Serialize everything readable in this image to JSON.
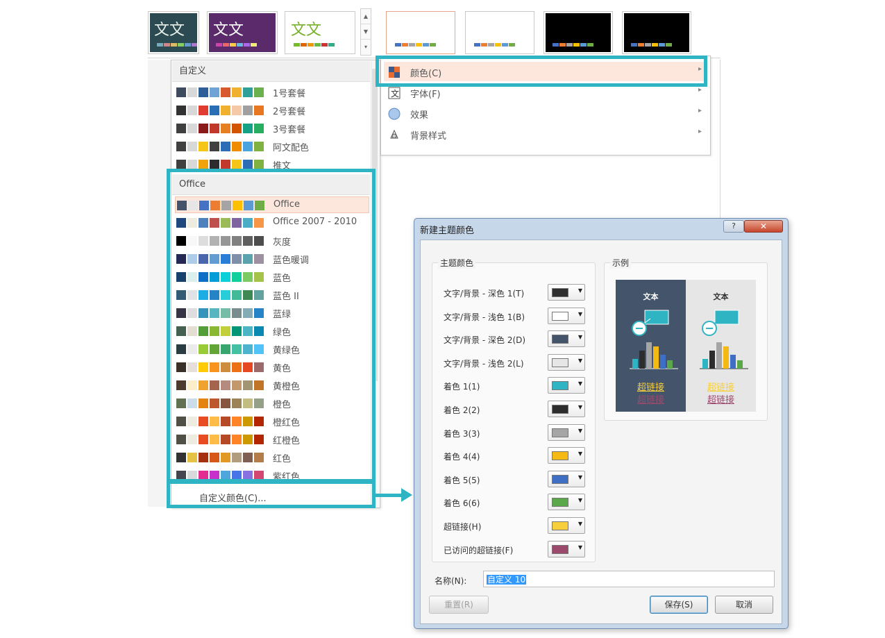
{
  "gallery": {
    "thumbs": [
      {
        "word": "文文",
        "bg": "#2b4a52",
        "fg": "#e8f0e8",
        "bars": [
          "#7ab",
          "#c88",
          "#db6",
          "#8c6",
          "#69c",
          "#a7c"
        ]
      },
      {
        "word": "文文",
        "bg": "#5b2a6b",
        "fg": "#ffffff",
        "bars": [
          "#c4a",
          "#e66",
          "#fc4",
          "#6bd",
          "#a6e",
          "#ee7"
        ]
      },
      {
        "word": "文文",
        "bg": "#ffffff",
        "fg": "#77b02a",
        "bars": [
          "#7b2",
          "#d60",
          "#e90",
          "#6b4",
          "#c33",
          "#3a8"
        ]
      },
      {
        "word": "",
        "bg": "#ffffff",
        "fg": "#000",
        "bars": [
          "#4472c4",
          "#ed7d31",
          "#a5a5a5",
          "#ffc000",
          "#5b9bd5",
          "#70ad47"
        ]
      },
      {
        "word": "",
        "bg": "#ffffff",
        "fg": "#000",
        "bars": [
          "#4472c4",
          "#ed7d31",
          "#a5a5a5",
          "#ffc000",
          "#5b9bd5",
          "#70ad47"
        ]
      },
      {
        "word": "",
        "bg": "#000000",
        "fg": "#fff",
        "bars": [
          "#4472c4",
          "#ed7d31",
          "#a5a5a5",
          "#ffc000",
          "#5b9bd5",
          "#70ad47"
        ]
      },
      {
        "word": "",
        "bg": "#000000",
        "fg": "#fff",
        "bars": [
          "#4472c4",
          "#ed7d31",
          "#a5a5a5",
          "#ffc000",
          "#5b9bd5",
          "#70ad47"
        ]
      }
    ]
  },
  "color_menu": {
    "custom_header": "自定义",
    "office_header": "Office",
    "custom_schemes": [
      {
        "name": "1号套餐",
        "colors": [
          "#3e4a5e",
          "#d8d8d8",
          "#2e5f99",
          "#6fa3d6",
          "#d75a2c",
          "#f0b030",
          "#2f9f9a",
          "#6ab04c"
        ]
      },
      {
        "name": "2号套餐",
        "colors": [
          "#333333",
          "#d8d8d8",
          "#e03c31",
          "#2a6eb5",
          "#f0b030",
          "#f5c8a8",
          "#a0a0a0",
          "#e87722"
        ]
      },
      {
        "name": "3号套餐",
        "colors": [
          "#404040",
          "#d8d8d8",
          "#8b1a1a",
          "#c0392b",
          "#e67e22",
          "#d35400",
          "#16a085",
          "#27ae60"
        ]
      },
      {
        "name": "阿文配色",
        "colors": [
          "#404040",
          "#d8d8d8",
          "#f5c518",
          "#404040",
          "#2d6db5",
          "#f08c00",
          "#4aa3df",
          "#7fb241"
        ]
      },
      {
        "name": "推文",
        "colors": [
          "#404040",
          "#d8d8d8",
          "#f0a30a",
          "#2d2d2d",
          "#c0392b",
          "#f5c518",
          "#2d6db5",
          "#7fb241"
        ]
      }
    ],
    "office_schemes": [
      {
        "name": "Office",
        "colors": [
          "#44546a",
          "#e7e6e6",
          "#4472c4",
          "#ed7d31",
          "#a5a5a5",
          "#ffc000",
          "#5b9bd5",
          "#70ad47"
        ]
      },
      {
        "name": "Office 2007 - 2010",
        "colors": [
          "#1f497d",
          "#eeece1",
          "#4f81bd",
          "#c0504d",
          "#9bbb59",
          "#8064a2",
          "#4bacc6",
          "#f79646"
        ]
      },
      {
        "name": "灰度",
        "colors": [
          "#000000",
          "#f8f8f8",
          "#dddddd",
          "#b2b2b2",
          "#969696",
          "#808080",
          "#5f5f5f",
          "#4d4d4d"
        ]
      },
      {
        "name": "蓝色暖调",
        "colors": [
          "#242852",
          "#acccea",
          "#4a66ac",
          "#629dd1",
          "#297fd5",
          "#7f8fa9",
          "#5aa2ae",
          "#9d90a0"
        ]
      },
      {
        "name": "蓝色",
        "colors": [
          "#17406d",
          "#dbefef",
          "#0f6fc6",
          "#009dd9",
          "#0bd0d9",
          "#10cf9b",
          "#7cca62",
          "#a5c249"
        ]
      },
      {
        "name": "蓝色 II",
        "colors": [
          "#335b74",
          "#dfe3e5",
          "#1cade4",
          "#2683c6",
          "#27ced7",
          "#42ba97",
          "#3e8853",
          "#62a39f"
        ]
      },
      {
        "name": "蓝绿",
        "colors": [
          "#373545",
          "#dedede",
          "#3494ba",
          "#58b6c0",
          "#75bda7",
          "#7a8c8e",
          "#84acb6",
          "#2683c6"
        ]
      },
      {
        "name": "绿色",
        "colors": [
          "#455f51",
          "#e3ded1",
          "#549e39",
          "#8ab833",
          "#c0cf3a",
          "#029676",
          "#4ab5c4",
          "#0989b1"
        ]
      },
      {
        "name": "黄绿色",
        "colors": [
          "#2c3c43",
          "#ebebeb",
          "#99cb38",
          "#63a537",
          "#37a76f",
          "#44c1a3",
          "#4eb3cf",
          "#51c3f9"
        ]
      },
      {
        "name": "黄色",
        "colors": [
          "#39302a",
          "#e5dedb",
          "#ffca08",
          "#f8931d",
          "#ce8d3e",
          "#ec7016",
          "#e64823",
          "#9c6a6a"
        ]
      },
      {
        "name": "黄橙色",
        "colors": [
          "#4e3b30",
          "#fbeec9",
          "#f0a22e",
          "#a5644e",
          "#b58b80",
          "#c3986d",
          "#a19574",
          "#c17529"
        ]
      },
      {
        "name": "橙色",
        "colors": [
          "#637052",
          "#ccddea",
          "#e48312",
          "#bd582c",
          "#865640",
          "#9b8357",
          "#c2bc80",
          "#94a088"
        ]
      },
      {
        "name": "橙红色",
        "colors": [
          "#505046",
          "#eeece1",
          "#e84c22",
          "#ffbd47",
          "#b64926",
          "#ff8427",
          "#cc9900",
          "#b22600"
        ]
      },
      {
        "name": "红橙色",
        "colors": [
          "#505046",
          "#eeece1",
          "#e84c22",
          "#ffbd47",
          "#b64926",
          "#ff8427",
          "#cc9900",
          "#b22600"
        ]
      },
      {
        "name": "红色",
        "colors": [
          "#323232",
          "#e5c243",
          "#a5300f",
          "#d55816",
          "#e19825",
          "#b19c7d",
          "#7f5f52",
          "#b27d49"
        ]
      },
      {
        "name": "紫红色",
        "colors": [
          "#454551",
          "#d8d9dc",
          "#e32d91",
          "#c830cc",
          "#4ea6dc",
          "#4775e7",
          "#8971e1",
          "#d54773"
        ]
      }
    ],
    "custom_color_action": "自定义颜色(C)..."
  },
  "design_submenu": {
    "items": [
      {
        "label": "颜色(C)",
        "icon": "color-palette-icon"
      },
      {
        "label": "字体(F)",
        "icon": "font-icon"
      },
      {
        "label": "效果",
        "icon": "effects-icon"
      },
      {
        "label": "背景样式",
        "icon": "background-style-icon"
      }
    ],
    "arrow": "▸"
  },
  "dialog": {
    "title": "新建主题颜色",
    "help": "?",
    "close": "✕",
    "theme_colors_caption": "主题颜色",
    "sample_caption": "示例",
    "rows": [
      {
        "label": "文字/背景 - 深色 1(T)",
        "color": "#2f2f2f"
      },
      {
        "label": "文字/背景 - 浅色 1(B)",
        "color": "#ffffff"
      },
      {
        "label": "文字/背景 - 深色 2(D)",
        "color": "#44546a"
      },
      {
        "label": "文字/背景 - 浅色 2(L)",
        "color": "#e7e6e6"
      },
      {
        "label": "着色 1(1)",
        "color": "#2fb4c3"
      },
      {
        "label": "着色 2(2)",
        "color": "#2d2d2d"
      },
      {
        "label": "着色 3(3)",
        "color": "#a5a5a5"
      },
      {
        "label": "着色 4(4)",
        "color": "#f5b914"
      },
      {
        "label": "着色 5(5)",
        "color": "#3f6fc4"
      },
      {
        "label": "着色 6(6)",
        "color": "#5aa84a"
      },
      {
        "label": "超链接(H)",
        "color": "#f7cf3c"
      },
      {
        "label": "已访问的超链接(F)",
        "color": "#9b4a6e"
      }
    ],
    "preview": {
      "dark_bg": "#44546a",
      "light_bg": "#e7e6e6",
      "text": "文本",
      "link": "超链接",
      "visited": "超链接"
    },
    "name_label": "名称(N):",
    "name_value": "自定义 10",
    "reset": "重置(R)",
    "save": "保存(S)",
    "cancel": "取消"
  }
}
